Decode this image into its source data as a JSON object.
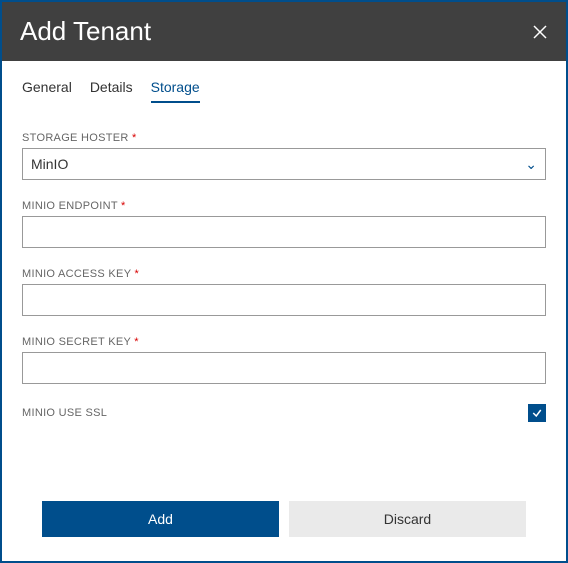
{
  "header": {
    "title": "Add Tenant"
  },
  "tabs": {
    "general": "General",
    "details": "Details",
    "storage": "Storage",
    "active": "storage"
  },
  "form": {
    "storage_hoster": {
      "label": "STORAGE HOSTER",
      "required": true,
      "value": "MinIO"
    },
    "minio_endpoint": {
      "label": "MINIO ENDPOINT",
      "required": true,
      "value": ""
    },
    "minio_access_key": {
      "label": "MINIO ACCESS KEY",
      "required": true,
      "value": ""
    },
    "minio_secret_key": {
      "label": "MINIO SECRET KEY",
      "required": true,
      "value": ""
    },
    "minio_use_ssl": {
      "label": "MINIO USE SSL",
      "checked": true
    }
  },
  "footer": {
    "add": "Add",
    "discard": "Discard"
  }
}
